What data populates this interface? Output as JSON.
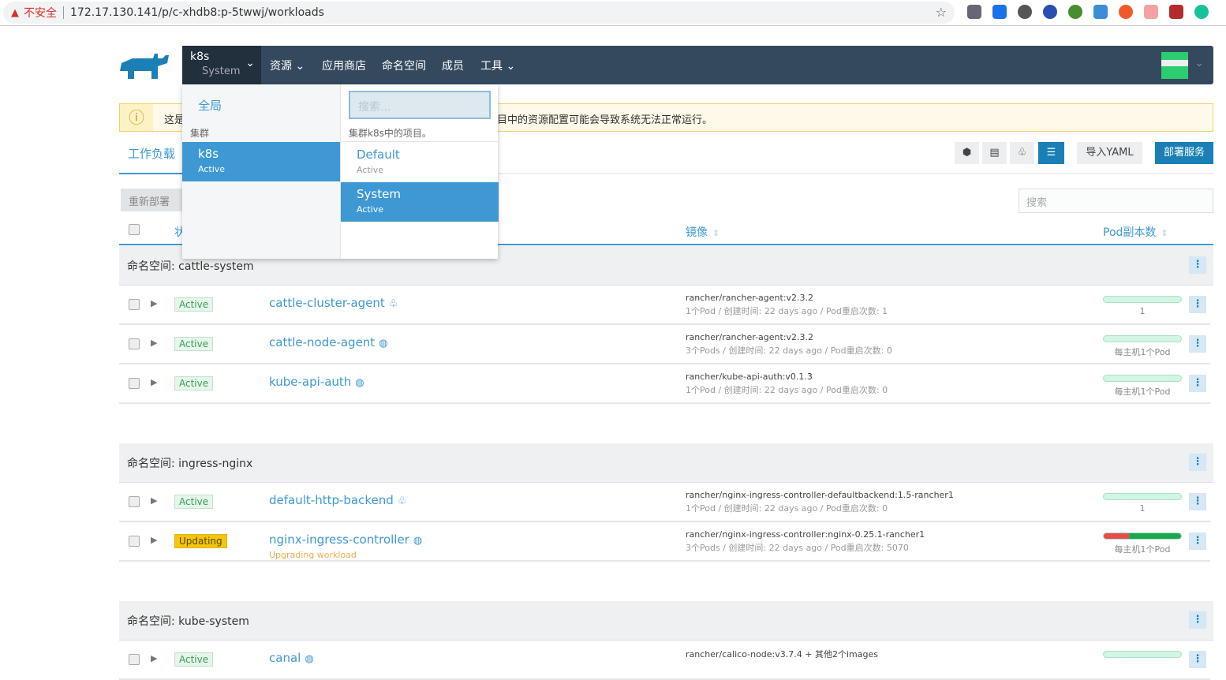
{
  "browser": {
    "security": "不安全",
    "url": "172.17.130.141/p/c-xhdb8:p-5twwj/workloads"
  },
  "nav": {
    "cluster": "k8s",
    "project": "System",
    "items": [
      "资源",
      "应用商店",
      "命名空间",
      "成员",
      "工具"
    ]
  },
  "dropdown": {
    "global": "全局",
    "cluster_label": "集群",
    "search_placeholder": "搜索...",
    "project_label": "集群k8s中的项目。",
    "clusters": [
      {
        "name": "k8s",
        "status": "Active"
      }
    ],
    "projects": [
      {
        "name": "Default",
        "status": "Active"
      },
      {
        "name": "System",
        "status": "Active"
      }
    ]
  },
  "alert": {
    "text_start": "这是",
    "text_end": "目中的资源配置可能会导致系统无法正常运行。"
  },
  "tabs": {
    "workloads": "工作负载"
  },
  "toolbar": {
    "import": "导入YAML",
    "deploy": "部署服务",
    "redeploy": "重新部署",
    "search_placeholder": "搜索"
  },
  "table": {
    "col_state": "状",
    "col_image": "镜像",
    "col_scale": "Pod副本数"
  },
  "groups": [
    {
      "label": "命名空间: cattle-system",
      "rows": [
        {
          "state": "Active",
          "name": "cattle-cluster-agent",
          "icon": "cluster-icon",
          "image": "rancher/rancher-agent:v2.3.2",
          "meta": "1个Pod / 创建时间: 22 days ago / Pod重启次数: 1",
          "scale": "1",
          "bad": 0
        },
        {
          "state": "Active",
          "name": "cattle-node-agent",
          "icon": "globe-icon",
          "image": "rancher/rancher-agent:v2.3.2",
          "meta": "3个Pods / 创建时间: 22 days ago / Pod重启次数: 0",
          "scale": "每主机1个Pod",
          "bad": 0
        },
        {
          "state": "Active",
          "name": "kube-api-auth",
          "icon": "globe-icon",
          "image": "rancher/kube-api-auth:v0.1.3",
          "meta": "1个Pod / 创建时间: 22 days ago / Pod重启次数: 0",
          "scale": "每主机1个Pod",
          "bad": 0
        }
      ]
    },
    {
      "label": "命名空间: ingress-nginx",
      "rows": [
        {
          "state": "Active",
          "name": "default-http-backend",
          "icon": "cluster-icon",
          "image": "rancher/nginx-ingress-controller-defaultbackend:1.5-rancher1",
          "meta": "1个Pod / 创建时间: 22 days ago / Pod重启次数: 0",
          "scale": "1",
          "bad": 0
        },
        {
          "state": "Updating",
          "name": "nginx-ingress-controller",
          "icon": "globe-icon",
          "sub": "Upgrading workload",
          "image": "rancher/nginx-ingress-controller:nginx-0.25.1-rancher1",
          "meta": "3个Pods / 创建时间: 22 days ago / Pod重启次数: 5070",
          "scale": "每主机1个Pod",
          "bad": 0.33
        }
      ]
    },
    {
      "label": "命名空间: kube-system",
      "rows": [
        {
          "state": "Active",
          "name": "canal",
          "icon": "globe-icon",
          "image": "rancher/calico-node:v3.7.4 + 其他2个images",
          "meta": "",
          "scale": "",
          "bad": 0
        }
      ]
    }
  ]
}
